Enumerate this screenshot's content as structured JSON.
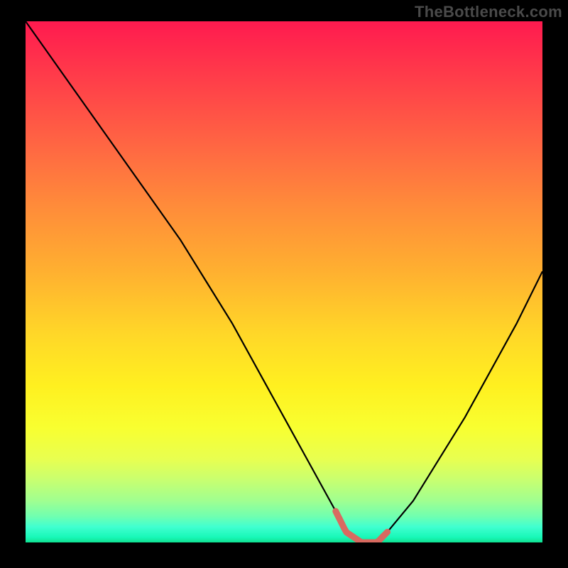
{
  "watermark": "TheBottleneck.com",
  "chart_data": {
    "type": "line",
    "title": "",
    "xlabel": "",
    "ylabel": "",
    "xlim": [
      0,
      100
    ],
    "ylim": [
      0,
      100
    ],
    "grid": false,
    "legend": false,
    "series": [
      {
        "name": "bottleneck-curve",
        "x": [
          0,
          5,
          10,
          15,
          20,
          25,
          30,
          35,
          40,
          45,
          50,
          55,
          60,
          62,
          65,
          68,
          70,
          75,
          80,
          85,
          90,
          95,
          100
        ],
        "values": [
          100,
          93,
          86,
          79,
          72,
          65,
          58,
          50,
          42,
          33,
          24,
          15,
          6,
          2,
          0,
          0,
          2,
          8,
          16,
          24,
          33,
          42,
          52
        ],
        "color": "#000000",
        "linewidth": 2
      }
    ],
    "highlight_region": {
      "name": "optimal-range",
      "x_start": 60,
      "x_end": 70,
      "color": "#d86a60"
    },
    "background_gradient": {
      "stops": [
        {
          "pos": 0.0,
          "color": "#ff1a4f"
        },
        {
          "pos": 0.1,
          "color": "#ff3a4a"
        },
        {
          "pos": 0.25,
          "color": "#ff6a42"
        },
        {
          "pos": 0.35,
          "color": "#ff8a3a"
        },
        {
          "pos": 0.48,
          "color": "#ffb030"
        },
        {
          "pos": 0.6,
          "color": "#ffd728"
        },
        {
          "pos": 0.7,
          "color": "#fff020"
        },
        {
          "pos": 0.78,
          "color": "#f8ff30"
        },
        {
          "pos": 0.84,
          "color": "#e8ff50"
        },
        {
          "pos": 0.88,
          "color": "#c8ff70"
        },
        {
          "pos": 0.92,
          "color": "#a0ff90"
        },
        {
          "pos": 0.95,
          "color": "#70ffb0"
        },
        {
          "pos": 0.97,
          "color": "#40ffd0"
        },
        {
          "pos": 0.99,
          "color": "#18f8b8"
        },
        {
          "pos": 1.0,
          "color": "#10e090"
        }
      ]
    }
  }
}
